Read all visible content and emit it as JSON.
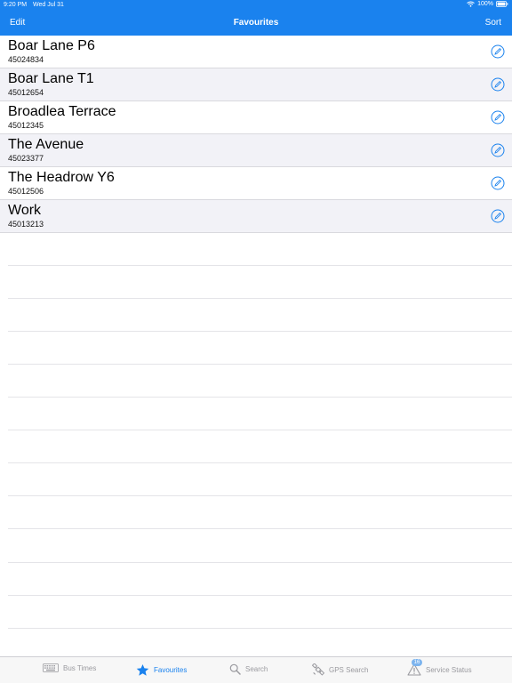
{
  "status_bar": {
    "time": "9:20 PM",
    "date": "Wed Jul 31",
    "battery": "100%",
    "icons": [
      "wifi-icon",
      "battery-icon"
    ]
  },
  "navbar": {
    "left_button": "Edit",
    "title": "Favourites",
    "right_button": "Sort",
    "color": "#1a82ee"
  },
  "favourites": [
    {
      "name": "Boar Lane P6",
      "code": "45024834"
    },
    {
      "name": "Boar Lane T1",
      "code": "45012654"
    },
    {
      "name": "Broadlea Terrace",
      "code": "45012345"
    },
    {
      "name": "The Avenue",
      "code": "45023377"
    },
    {
      "name": "The Headrow Y6",
      "code": "45012506"
    },
    {
      "name": "Work",
      "code": "45013213"
    }
  ],
  "row_icon": "edit-pencil-icon",
  "tabbar": {
    "tabs": [
      {
        "label": "Bus Times",
        "icon": "keyboard-icon",
        "active": false
      },
      {
        "label": "Favourites",
        "icon": "star-icon",
        "active": true
      },
      {
        "label": "Search",
        "icon": "search-icon",
        "active": false
      },
      {
        "label": "GPS Search",
        "icon": "satellite-icon",
        "active": false
      },
      {
        "label": "Service Status",
        "icon": "warning-icon",
        "active": false,
        "badge": "16"
      }
    ],
    "active_color": "#1a82ee",
    "inactive_color": "#9a9a9f"
  }
}
